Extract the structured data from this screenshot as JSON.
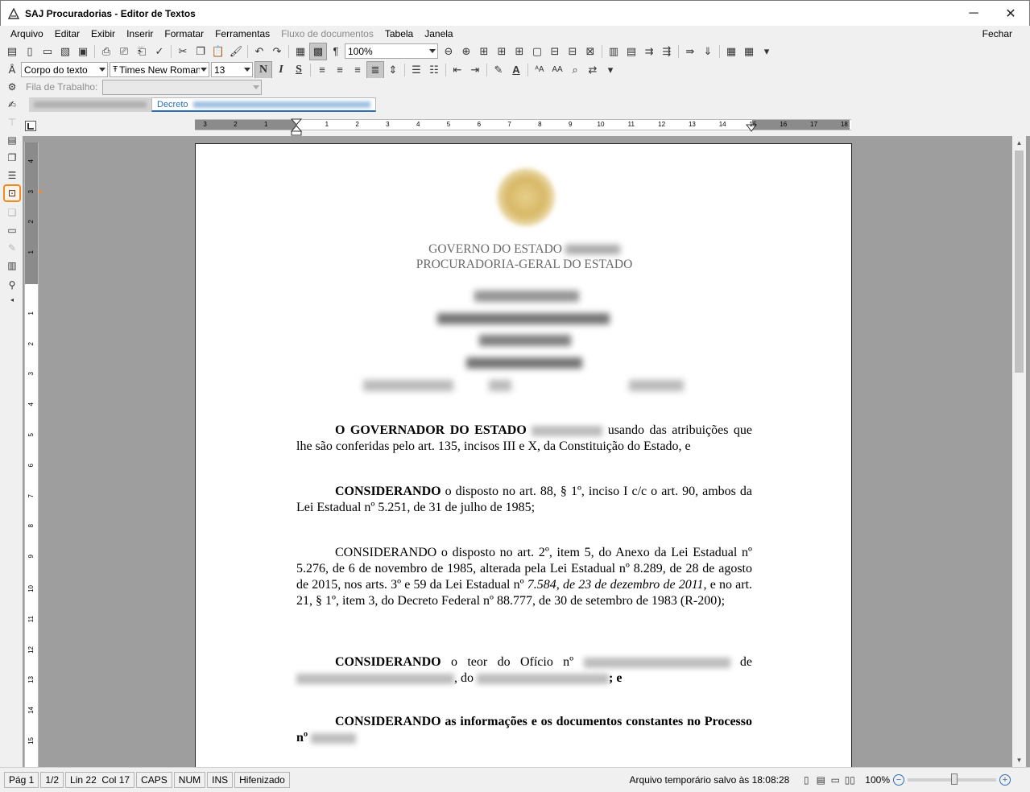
{
  "window": {
    "title": "SAJ Procuradorias - Editor de Textos",
    "minimize": "─",
    "close": "✕"
  },
  "menu": {
    "items": [
      "Arquivo",
      "Editar",
      "Exibir",
      "Inserir",
      "Formatar",
      "Ferramentas",
      "Fluxo de documentos",
      "Tabela",
      "Janela"
    ],
    "close_label": "Fechar"
  },
  "toolbar": {
    "zoom": "100%",
    "style": "Corpo do texto",
    "font": "Times New Roman",
    "size": "13",
    "bold": "N",
    "italic": "I",
    "strike": "S",
    "workflow_label": "Fila de Trabalho:"
  },
  "tabs": {
    "active_label": "Decreto"
  },
  "document": {
    "header_line1": "GOVERNO DO ESTADO",
    "header_line2": "PROCURADORIA-GERAL DO ESTADO",
    "p1_bold": "O GOVERNADOR DO ESTADO",
    "p1_text": "usando das atribuições que lhe são conferidas pelo art. 135, incisos III e X, da Constituição do Estado, e",
    "p2_bold": "CONSIDERANDO",
    "p2_text": "o disposto no art. 88, § 1º, inciso I c/c o art. 90, ambos da Lei Estadual nº 5.251, de 31 de julho de 1985;",
    "p3_text1": "CONSIDERANDO o disposto no art. 2º, item 5, do Anexo da Lei Estadual nº 5.276, de 6 de novembro de 1985, alterada pela Lei Estadual nº 8.289, de 28 de agosto de 2015, nos arts. 3º e 59 da Lei Estadual nº",
    "p3_italic": "7.584, de 23 de dezembro de 2011,",
    "p3_text2": "e no art. 21, § 1º, item 3, do Decreto Federal nº 88.777, de 30 de setembro de 1983 (R-200);",
    "p4_bold": "CONSIDERANDO",
    "p4_text1": "o teor do Ofício nº",
    "p4_text2": "de",
    "p4_text3": ", do",
    "p4_text4": "; e",
    "p5_bold": "CONSIDERANDO as informações e os documentos constantes no Processo nº"
  },
  "status": {
    "page": "Pág 1",
    "pages": "1/2",
    "position": "Lin 22  Col 17",
    "caps": "CAPS",
    "num": "NUM",
    "ins": "INS",
    "hyphen": "Hifenizado",
    "saved": "Arquivo temporário salvo às 18:08:28",
    "zoom": "100%"
  },
  "colors": {
    "accent": "#2a6fb8",
    "highlight": "#f08a24"
  },
  "ruler": {
    "h_labels": [
      "3",
      "2",
      "1",
      "1",
      "2",
      "3",
      "4",
      "5",
      "6",
      "7",
      "8",
      "9",
      "10",
      "11",
      "12",
      "13",
      "14",
      "15",
      "16",
      "17",
      "18"
    ],
    "v_labels": [
      "4",
      "3",
      "2",
      "1",
      "1",
      "2",
      "3",
      "4",
      "5",
      "6",
      "7",
      "8",
      "9",
      "10",
      "11",
      "12",
      "13",
      "14",
      "15"
    ]
  }
}
